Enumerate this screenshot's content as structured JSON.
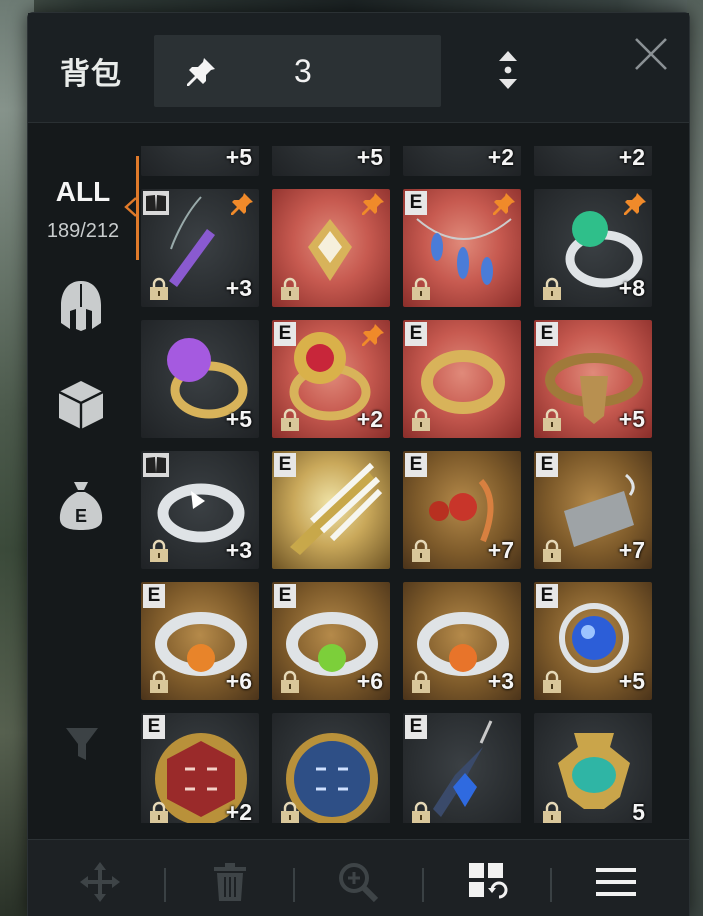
{
  "header": {
    "title": "背包",
    "pin_count": "3"
  },
  "sidebar": {
    "all_label": "ALL",
    "capacity": "189/212",
    "tabs": [
      {
        "icon": "helmet-icon"
      },
      {
        "icon": "crate-icon"
      },
      {
        "icon": "money-bag-icon",
        "label": "E"
      }
    ],
    "filter_icon": "funnel-icon"
  },
  "inventory": {
    "top_partial_row": [
      {
        "plus": "+5"
      },
      {
        "plus": "+5"
      },
      {
        "plus": "+2"
      },
      {
        "plus": "+2"
      }
    ],
    "rows": [
      [
        {
          "item": "amethyst-pendant-necklace",
          "bg": "dark",
          "badge": "book",
          "pinned": true,
          "locked": true,
          "plus": "+3"
        },
        {
          "item": "gold-diamond-pendant-necklace",
          "bg": "red",
          "badge": "",
          "pinned": true,
          "locked": true,
          "plus": ""
        },
        {
          "item": "sapphire-drop-necklace",
          "bg": "red",
          "badge": "E",
          "pinned": true,
          "locked": true,
          "plus": ""
        },
        {
          "item": "emerald-silver-ring",
          "bg": "dark",
          "badge": "",
          "pinned": true,
          "locked": true,
          "plus": "+8"
        }
      ],
      [
        {
          "item": "amethyst-gold-ring",
          "bg": "dark",
          "badge": "",
          "pinned": false,
          "locked": false,
          "plus": "+5"
        },
        {
          "item": "ruby-sunburst-ring",
          "bg": "red",
          "badge": "E",
          "pinned": true,
          "locked": true,
          "plus": "+2"
        },
        {
          "item": "plain-gold-band-ring",
          "bg": "red",
          "badge": "E",
          "pinned": false,
          "locked": true,
          "plus": ""
        },
        {
          "item": "dragon-head-ring",
          "bg": "red",
          "badge": "E",
          "pinned": false,
          "locked": true,
          "plus": "+5"
        }
      ],
      [
        {
          "item": "silver-twist-ring",
          "bg": "dark",
          "badge": "book",
          "pinned": false,
          "locked": true,
          "plus": "+3"
        },
        {
          "item": "golden-feather-bracer",
          "bg": "brightgold",
          "badge": "E",
          "pinned": false,
          "locked": false,
          "plus": ""
        },
        {
          "item": "ruby-flame-earring",
          "bg": "gold",
          "badge": "E",
          "pinned": false,
          "locked": true,
          "plus": "+7"
        },
        {
          "item": "silver-claw-earring",
          "bg": "gold",
          "badge": "E",
          "pinned": false,
          "locked": true,
          "plus": "+7"
        }
      ],
      [
        {
          "item": "topaz-silver-ring",
          "bg": "gold",
          "badge": "E",
          "pinned": false,
          "locked": true,
          "plus": "+6"
        },
        {
          "item": "peridot-silver-ring",
          "bg": "gold",
          "badge": "E",
          "pinned": false,
          "locked": true,
          "plus": "+6"
        },
        {
          "item": "amber-silver-ring",
          "bg": "gold",
          "badge": "",
          "pinned": false,
          "locked": true,
          "plus": "+3"
        },
        {
          "item": "sapphire-orb-amulet",
          "bg": "gold",
          "badge": "E",
          "pinned": false,
          "locked": true,
          "plus": "+5"
        }
      ],
      [
        {
          "item": "red-rune-medallion",
          "bg": "dark",
          "badge": "E",
          "pinned": false,
          "locked": true,
          "plus": "+2"
        },
        {
          "item": "blue-rune-medallion",
          "bg": "dark",
          "badge": "",
          "pinned": false,
          "locked": true,
          "plus": ""
        },
        {
          "item": "sapphire-drop-earring",
          "bg": "dark",
          "badge": "E",
          "pinned": false,
          "locked": true,
          "plus": ""
        },
        {
          "item": "jade-urn",
          "bg": "dark",
          "badge": "",
          "pinned": false,
          "locked": true,
          "plus": "5"
        }
      ]
    ]
  },
  "bottom_bar": {
    "icons": [
      "move-icon",
      "trash-icon",
      "zoom-icon",
      "sort-grid-icon",
      "menu-icon"
    ]
  },
  "colors": {
    "accent_orange": "#e07a2a",
    "panel_bg": "#15191b",
    "pin_box_bg": "#2b3134"
  }
}
